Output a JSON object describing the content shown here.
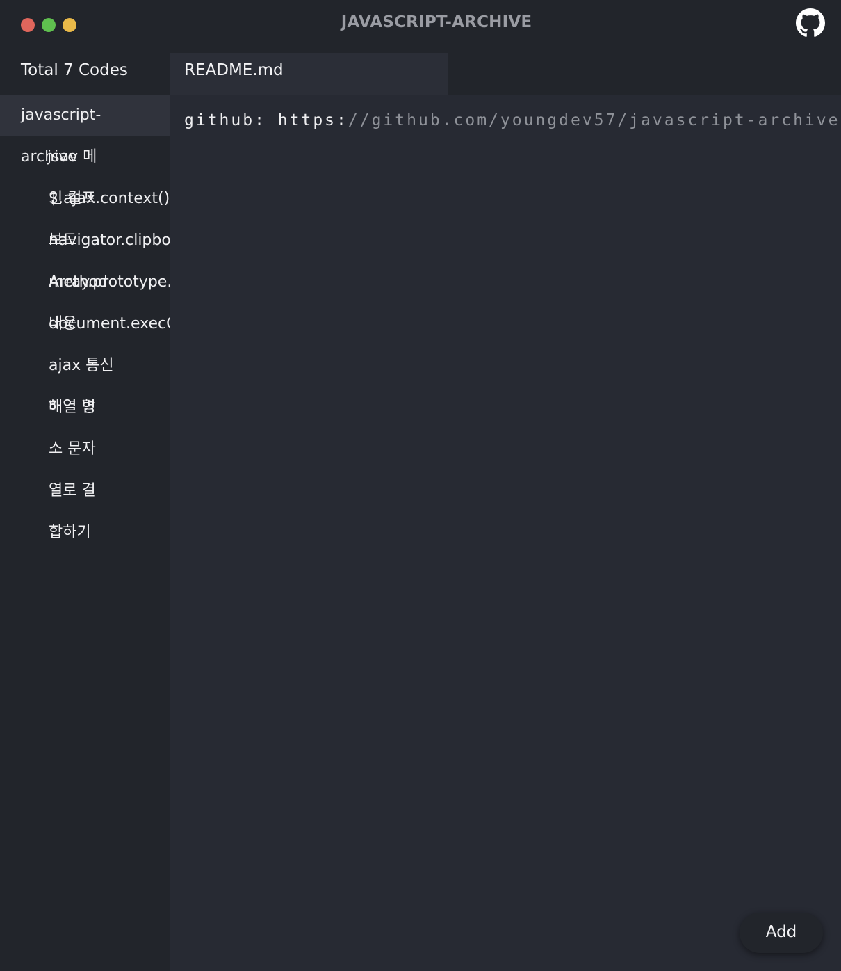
{
  "window": {
    "title": "JAVASCRIPT-ARCHIVE",
    "github_icon": "github-icon"
  },
  "sidebar": {
    "total_label": "Total 7 Codes",
    "rows": [
      {
        "primary": "javascript-",
        "active": true
      },
      {
        "primary": "archive",
        "overlap": "jsav 메"
      },
      {
        "primary": "$.ajax.context()",
        "overlap": "인 컬프"
      },
      {
        "primary": "navigator.clipboard",
        "overlap": "보드"
      },
      {
        "primary": "Array.prototype.",
        "overlap": "method"
      },
      {
        "primary": "document.execC",
        "overlap": "내용"
      },
      {
        "primary": "ajax 통신"
      },
      {
        "primary": "배열 병",
        "overlap": "해열 합"
      },
      {
        "primary": "소 문자"
      },
      {
        "primary": "열로 결"
      },
      {
        "primary": "합하기"
      }
    ]
  },
  "tabs": [
    {
      "label": "README.md",
      "active": true
    }
  ],
  "editor": {
    "key": "github:",
    "url_head": "https:",
    "url_rest": "//github.com/youngdev57/javascript-archive"
  },
  "actions": {
    "add_label": "Add"
  },
  "colors": {
    "background": "#272a33",
    "sidebar": "#22252b",
    "active_row": "#30333c",
    "traffic_close": "#e0665c",
    "traffic_min": "#5fbf4f",
    "traffic_max": "#e9b949"
  }
}
